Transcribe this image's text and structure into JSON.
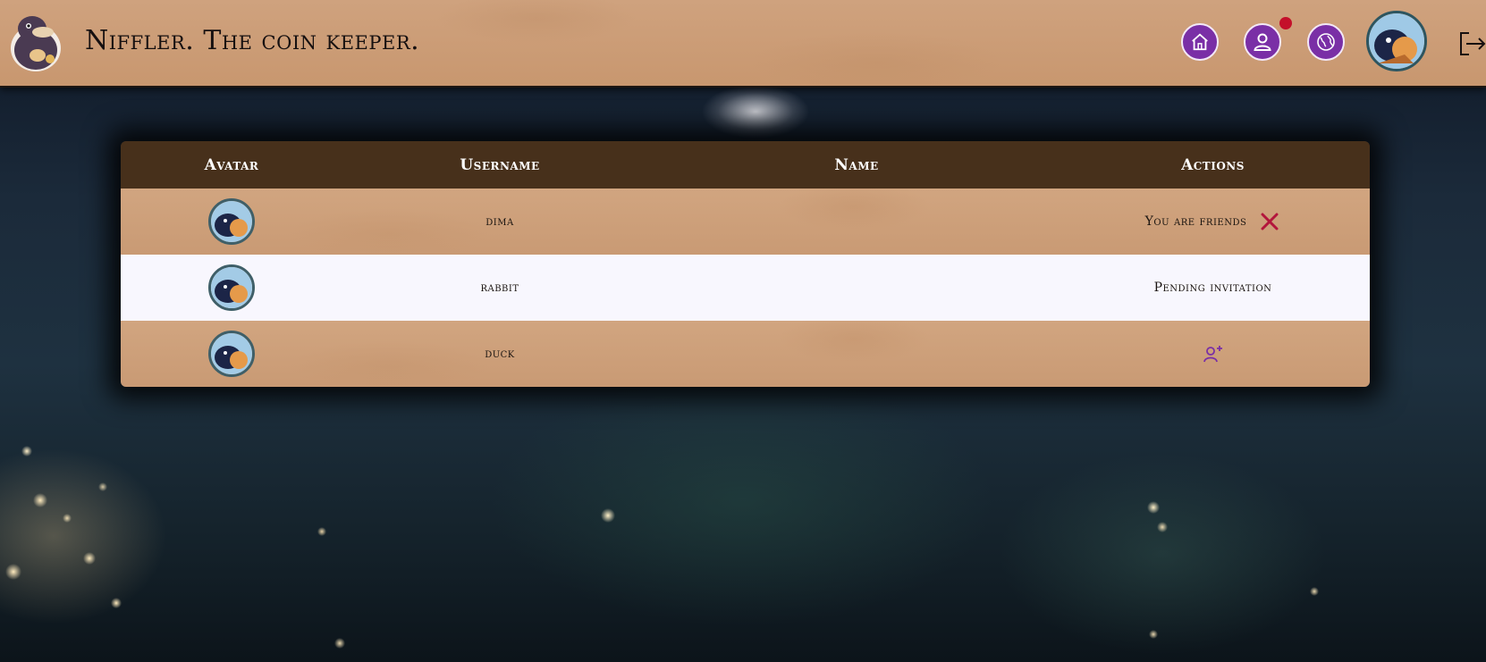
{
  "header": {
    "title": "Niffler. The coin keeper.",
    "nav": {
      "home_icon": "home-icon",
      "profile_icon": "user-icon",
      "friends_icon": "globe-icon",
      "logout_icon": "logout-icon"
    },
    "has_notification": true,
    "colors": {
      "nav_button": "#7a2fa6",
      "notification": "#c4102a"
    }
  },
  "table": {
    "columns": [
      "Avatar",
      "Username",
      "Name",
      "Actions"
    ],
    "rows": [
      {
        "username": "dima",
        "name": "",
        "action": "You are friends",
        "action_icon": "close-icon"
      },
      {
        "username": "rabbit",
        "name": "",
        "action": "Pending invitation",
        "action_icon": ""
      },
      {
        "username": "duck",
        "name": "",
        "action": "",
        "action_icon": "add-friend-icon"
      }
    ],
    "colors": {
      "header_bg": "#47301b",
      "remove_icon": "#b3163c",
      "add_icon": "#7a2fa6"
    }
  }
}
